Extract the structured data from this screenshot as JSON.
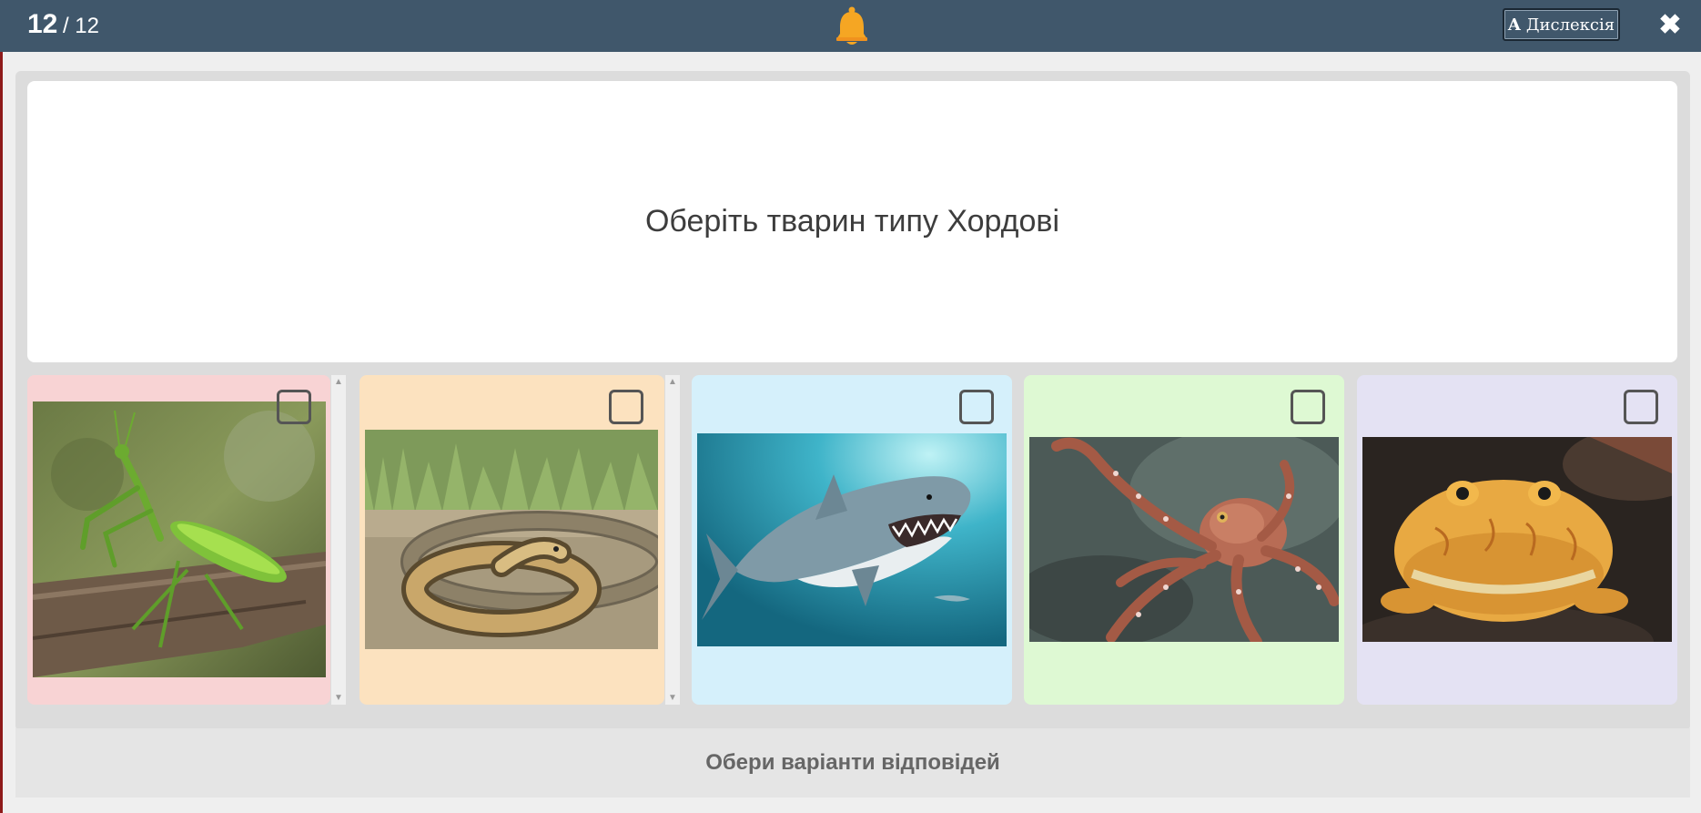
{
  "header": {
    "counter_current": "12",
    "counter_total": "/ 12",
    "dyslexia_label": "Дислексія",
    "dyslexia_icon": "A",
    "close_icon": "✖"
  },
  "question": {
    "text": "Оберіть тварин типу Хордові"
  },
  "options": [
    {
      "animal": "mantis-image",
      "bg": "#f8d3d4",
      "checked": false
    },
    {
      "animal": "snake-image",
      "bg": "#fce2bf",
      "checked": false
    },
    {
      "animal": "shark-image",
      "bg": "#d5f0fb",
      "checked": false
    },
    {
      "animal": "octopus-image",
      "bg": "#def9d3",
      "checked": false
    },
    {
      "animal": "frog-image",
      "bg": "#e4e2f3",
      "checked": false
    }
  ],
  "footer": {
    "prompt": "Обери варіанти відповідей"
  },
  "colors": {
    "topbar": "#40576b",
    "bell": "#f5a623"
  }
}
